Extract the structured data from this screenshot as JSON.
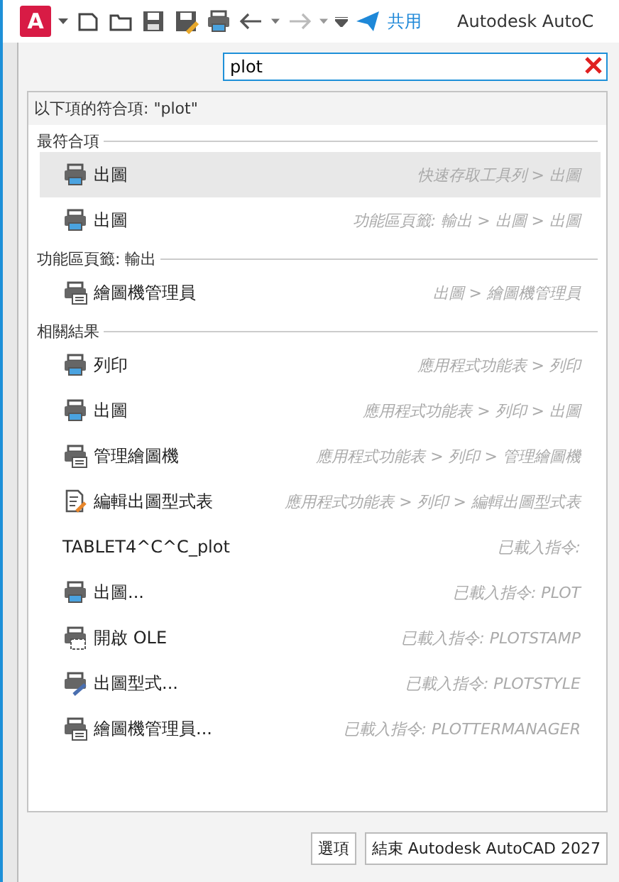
{
  "toolbar": {
    "app_letter": "A",
    "share": "共用",
    "title": "Autodesk AutoC"
  },
  "search": {
    "value": "plot"
  },
  "results": {
    "header": "以下項的符合項: \"plot\"",
    "sections": [
      {
        "title": "最符合項",
        "items": [
          {
            "kind": "printer",
            "label": "出圖",
            "path": "快速存取工具列 > 出圖",
            "selected": true
          },
          {
            "kind": "printer",
            "label": "出圖",
            "path": "功能區頁籤: 輸出 > 出圖 > 出圖",
            "selected": false
          }
        ]
      },
      {
        "title": "功能區頁籤: 輸出",
        "items": [
          {
            "kind": "plotter",
            "label": "繪圖機管理員",
            "path": "出圖 > 繪圖機管理員",
            "selected": false
          }
        ]
      },
      {
        "title": "相關結果",
        "items": [
          {
            "kind": "printer",
            "label": "列印",
            "path": "應用程式功能表 > 列印",
            "selected": false
          },
          {
            "kind": "printer",
            "label": "出圖",
            "path": "應用程式功能表 > 列印 > 出圖",
            "selected": false
          },
          {
            "kind": "plotter",
            "label": "管理繪圖機",
            "path": "應用程式功能表 > 列印 > 管理繪圖機",
            "selected": false
          },
          {
            "kind": "edit",
            "label": "編輯出圖型式表",
            "path": "應用程式功能表 > 列印 > 編輯出圖型式表",
            "selected": false
          },
          {
            "kind": "text",
            "label": "TABLET4^C^C_plot",
            "path": "已載入指令:",
            "selected": false
          },
          {
            "kind": "printer",
            "label": "出圖...",
            "path": "已載入指令: PLOT",
            "selected": false
          },
          {
            "kind": "stamp",
            "label": "開啟 OLE",
            "path": "已載入指令: PLOTSTAMP",
            "selected": false
          },
          {
            "kind": "style",
            "label": "出圖型式...",
            "path": "已載入指令: PLOTSTYLE",
            "selected": false
          },
          {
            "kind": "plotter",
            "label": "繪圖機管理員...",
            "path": "已載入指令: PLOTTERMANAGER",
            "selected": false
          }
        ]
      }
    ]
  },
  "buttons": [
    "選項",
    "結束 Autodesk AutoCAD 2027"
  ]
}
